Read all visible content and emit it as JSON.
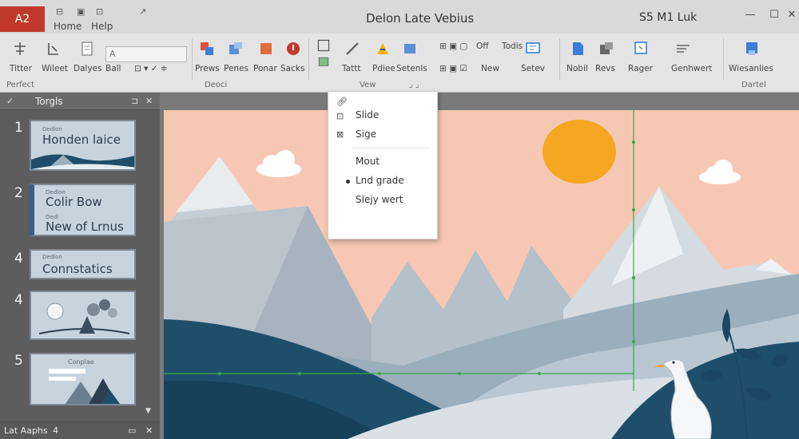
{
  "titlebar": {
    "app_badge": "A2",
    "menu_home": "Home",
    "menu_help": "Help",
    "doc_title": "Delon Late Vebius",
    "user_name": "S5 M1 Luk"
  },
  "ribbon": {
    "buttons": {
      "titter": "Titter",
      "wileet": "Wileet",
      "dalyes": "Dalyes",
      "ball": "Ball",
      "prews": "Prews",
      "penes": "Penes",
      "ponar": "Ponar",
      "sacks": "Sacks",
      "tattt": "Tattt",
      "pdiee": "Pdiee",
      "setenls": "Setenls",
      "off": "Off",
      "tocdis": "Todis",
      "new": "New",
      "setev": "Setev",
      "nobil": "Nobil",
      "revs": "Revs",
      "rager": "Rager",
      "genhwert": "Genhwert",
      "wiesanlies": "Wiesanlies"
    },
    "groups": {
      "perfect": "Perfect",
      "deoci": "Deoci",
      "view": "Vew",
      "dartel": "Dartel"
    },
    "font_input": "A"
  },
  "slides_pane": {
    "header": "Torgls",
    "status": "Lat Aaphs",
    "status_count": "4",
    "slides": [
      {
        "num": "1",
        "small": "Dedlon",
        "line1": "Honden laice",
        "line2": ""
      },
      {
        "num": "2",
        "small": "Dedlon",
        "line1": "Colir Bow",
        "small2": "Dedl",
        "line2": "New of Lrnus"
      },
      {
        "num": "4",
        "small": "Dedlon",
        "line1": "Connstatics",
        "line2": ""
      },
      {
        "num": "4",
        "small": "",
        "line1": "",
        "line2": ""
      },
      {
        "num": "5",
        "small": "Conplae",
        "line1": "",
        "line2": ""
      }
    ]
  },
  "dropdown": {
    "items": [
      "Slide",
      "Sige",
      "Mout",
      "Lnd grade",
      "Slejy wert"
    ]
  },
  "colors": {
    "sky": "#f6c8b4",
    "sun": "#f5a623",
    "mountain_light": "#c5ced6",
    "mountain_snow": "#e8ecef",
    "hill_dark": "#1f4e6b",
    "hill_mid": "#9aaebc",
    "guide_line": "#3aa845",
    "badge": "#c0392b"
  }
}
